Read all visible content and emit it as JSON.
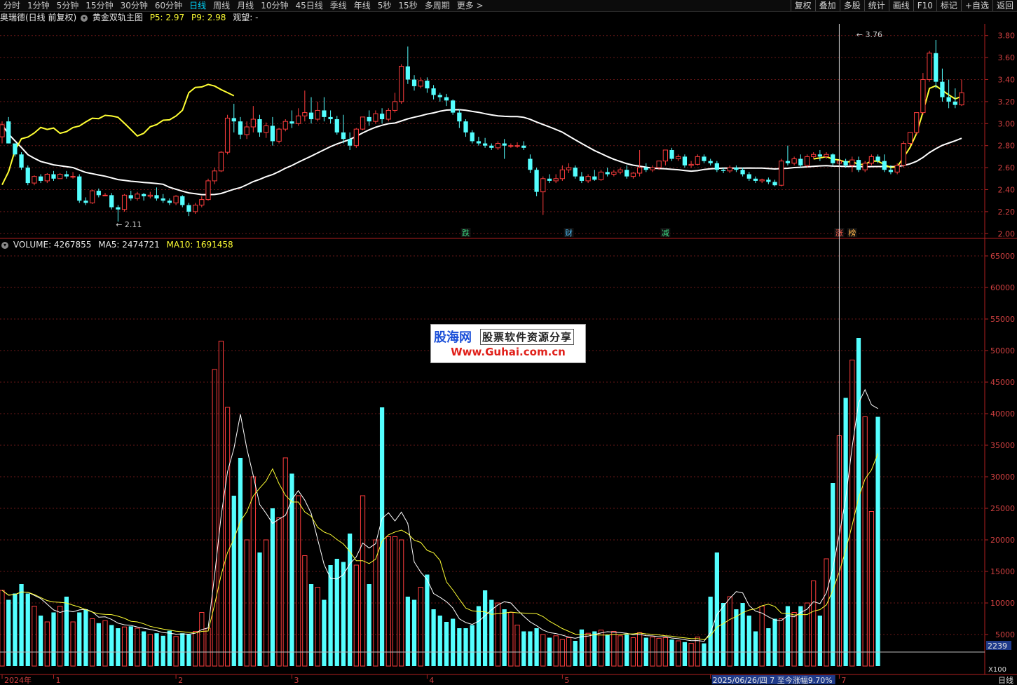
{
  "topbar": {
    "period_tabs": [
      "分时",
      "1分钟",
      "5分钟",
      "15分钟",
      "30分钟",
      "60分钟",
      "日线",
      "周线",
      "月线",
      "10分钟",
      "45日线",
      "季线",
      "年线",
      "5秒",
      "15秒",
      "多周期",
      "更多 >"
    ],
    "active_tab": "日线",
    "tool_tabs": [
      "复权",
      "叠加",
      "多股",
      "统计",
      "画线",
      "F10",
      "标记",
      "+自选",
      "返回"
    ]
  },
  "main_header": {
    "stock": "奥瑞德(日线 前复权)",
    "indicator": "黄金双轨主图",
    "p5_label": "P5: 2.97",
    "p9_label": "P9: 2.98",
    "view_label": "观望: -"
  },
  "volume_header": {
    "title": "VOLUME: 4267855",
    "ma5": "MA5: 2474721",
    "ma10": "MA10: 1691458"
  },
  "chart_data": [
    {
      "type": "candlestick",
      "title": "奥瑞德(日线 前复权)",
      "ylim": [
        1.97,
        3.9
      ],
      "y_ticks": [
        2.0,
        2.2,
        2.4,
        2.6,
        2.8,
        3.0,
        3.2,
        3.4,
        3.6,
        3.8
      ],
      "y_tick_labels": [
        "2.00",
        "2.20",
        "2.40",
        "2.60",
        "2.80",
        "3.00",
        "3.20",
        "3.40",
        "3.60",
        "3.80"
      ],
      "annotations": [
        {
          "text": "2.11",
          "bar": 17,
          "value": 2.11
        },
        {
          "text": "3.76",
          "bar": 132,
          "value": 3.76
        }
      ],
      "event_markers": [
        {
          "text": "跌",
          "bar": 72,
          "color": "#3ddc84"
        },
        {
          "text": "财",
          "bar": 88,
          "color": "#4fc3ff"
        },
        {
          "text": "减",
          "bar": 103,
          "color": "#3ddc84"
        },
        {
          "text": "涨",
          "bar": 130,
          "color": "#ff5a4a"
        },
        {
          "text": "榜",
          "bar": 132,
          "color": "#ffb34a"
        }
      ],
      "candles": [
        [
          2.88,
          3.02,
          2.99,
          2.82
        ],
        [
          3.02,
          3.06,
          2.82,
          2.82
        ],
        [
          2.82,
          2.82,
          2.72,
          2.7
        ],
        [
          2.72,
          2.74,
          2.6,
          2.58
        ],
        [
          2.6,
          2.62,
          2.46,
          2.44
        ],
        [
          2.46,
          2.53,
          2.52,
          2.44
        ],
        [
          2.52,
          2.54,
          2.48,
          2.46
        ],
        [
          2.48,
          2.55,
          2.54,
          2.46
        ],
        [
          2.54,
          2.57,
          2.5,
          2.48
        ],
        [
          2.5,
          2.55,
          2.54,
          2.5
        ],
        [
          2.54,
          2.57,
          2.52,
          2.5
        ],
        [
          2.52,
          2.56,
          2.52,
          2.5
        ],
        [
          2.52,
          2.54,
          2.3,
          2.28
        ],
        [
          2.3,
          2.33,
          2.28,
          2.26
        ],
        [
          2.28,
          2.4,
          2.39,
          2.27
        ],
        [
          2.39,
          2.41,
          2.35,
          2.33
        ],
        [
          2.35,
          2.37,
          2.35,
          2.35
        ],
        [
          2.35,
          2.37,
          2.24,
          2.22
        ],
        [
          2.24,
          2.26,
          2.22,
          2.11
        ],
        [
          2.22,
          2.36,
          2.35,
          2.2
        ],
        [
          2.35,
          2.39,
          2.32,
          2.3
        ],
        [
          2.32,
          2.38,
          2.36,
          2.3
        ],
        [
          2.36,
          2.37,
          2.34,
          2.3
        ],
        [
          2.34,
          2.38,
          2.35,
          2.32
        ],
        [
          2.35,
          2.42,
          2.32,
          2.3
        ],
        [
          2.32,
          2.36,
          2.3,
          2.28
        ],
        [
          2.3,
          2.32,
          2.28,
          2.26
        ],
        [
          2.28,
          2.35,
          2.34,
          2.26
        ],
        [
          2.34,
          2.35,
          2.26,
          2.24
        ],
        [
          2.26,
          2.28,
          2.2,
          2.16
        ],
        [
          2.2,
          2.28,
          2.26,
          2.18
        ],
        [
          2.26,
          2.34,
          2.31,
          2.24
        ],
        [
          2.31,
          2.5,
          2.48,
          2.3
        ],
        [
          2.48,
          2.6,
          2.57,
          2.45
        ],
        [
          2.57,
          2.75,
          2.74,
          2.56
        ],
        [
          2.74,
          3.08,
          3.05,
          2.72
        ],
        [
          3.05,
          3.18,
          3.02,
          2.92
        ],
        [
          3.02,
          3.06,
          2.9,
          2.86
        ],
        [
          2.9,
          3.02,
          2.97,
          2.86
        ],
        [
          2.97,
          3.16,
          3.04,
          2.92
        ],
        [
          3.04,
          3.08,
          2.92,
          2.88
        ],
        [
          2.92,
          3.01,
          2.98,
          2.87
        ],
        [
          2.98,
          3.06,
          2.84,
          2.8
        ],
        [
          2.84,
          2.96,
          2.95,
          2.82
        ],
        [
          2.95,
          3.04,
          3.02,
          2.93
        ],
        [
          3.02,
          3.12,
          3.0,
          2.96
        ],
        [
          3.0,
          3.14,
          3.07,
          2.98
        ],
        [
          3.07,
          3.3,
          3.1,
          3.02
        ],
        [
          3.1,
          3.24,
          3.04,
          3.0
        ],
        [
          3.04,
          3.2,
          3.12,
          3.02
        ],
        [
          3.12,
          3.24,
          3.06,
          3.02
        ],
        [
          3.06,
          3.12,
          3.04,
          3.0
        ],
        [
          3.04,
          3.07,
          2.92,
          2.9
        ],
        [
          2.92,
          3.08,
          2.86,
          2.82
        ],
        [
          2.86,
          2.92,
          2.8,
          2.76
        ],
        [
          2.8,
          2.96,
          2.95,
          2.78
        ],
        [
          2.95,
          3.05,
          3.06,
          2.94
        ],
        [
          3.06,
          3.12,
          3.02,
          2.98
        ],
        [
          3.02,
          3.12,
          3.09,
          3.0
        ],
        [
          3.09,
          3.14,
          3.04,
          3.0
        ],
        [
          3.04,
          3.14,
          3.12,
          3.02
        ],
        [
          3.12,
          3.28,
          3.2,
          3.1
        ],
        [
          3.2,
          3.54,
          3.52,
          3.18
        ],
        [
          3.52,
          3.7,
          3.4,
          3.36
        ],
        [
          3.4,
          3.44,
          3.34,
          3.3
        ],
        [
          3.34,
          3.42,
          3.39,
          3.32
        ],
        [
          3.39,
          3.42,
          3.32,
          3.28
        ],
        [
          3.32,
          3.35,
          3.26,
          3.22
        ],
        [
          3.26,
          3.28,
          3.24,
          3.2
        ],
        [
          3.24,
          3.27,
          3.21,
          3.16
        ],
        [
          3.21,
          3.22,
          3.1,
          3.08
        ],
        [
          3.1,
          3.13,
          3.02,
          2.96
        ],
        [
          3.02,
          3.04,
          2.92,
          2.88
        ],
        [
          2.92,
          2.94,
          2.84,
          2.82
        ],
        [
          2.84,
          2.88,
          2.82,
          2.8
        ],
        [
          2.82,
          2.87,
          2.8,
          2.78
        ],
        [
          2.8,
          2.82,
          2.78,
          2.76
        ],
        [
          2.78,
          2.84,
          2.82,
          2.76
        ],
        [
          2.82,
          2.86,
          2.8,
          2.68
        ],
        [
          2.8,
          2.82,
          2.8,
          2.78
        ],
        [
          2.8,
          2.83,
          2.8,
          2.78
        ],
        [
          2.8,
          2.84,
          2.78,
          2.76
        ],
        [
          2.68,
          2.72,
          2.58,
          2.55
        ],
        [
          2.58,
          2.6,
          2.38,
          2.34
        ],
        [
          2.38,
          2.52,
          2.5,
          2.17
        ],
        [
          2.5,
          2.54,
          2.48,
          2.46
        ],
        [
          2.48,
          2.54,
          2.5,
          2.46
        ],
        [
          2.5,
          2.62,
          2.58,
          2.48
        ],
        [
          2.58,
          2.64,
          2.6,
          2.55
        ],
        [
          2.6,
          2.62,
          2.52,
          2.5
        ],
        [
          2.52,
          2.56,
          2.48,
          2.46
        ],
        [
          2.48,
          2.54,
          2.52,
          2.46
        ],
        [
          2.52,
          2.58,
          2.49,
          2.48
        ],
        [
          2.49,
          2.58,
          2.56,
          2.48
        ],
        [
          2.56,
          2.6,
          2.54,
          2.52
        ],
        [
          2.54,
          2.58,
          2.56,
          2.52
        ],
        [
          2.56,
          2.6,
          2.58,
          2.54
        ],
        [
          2.58,
          2.62,
          2.52,
          2.5
        ],
        [
          2.52,
          2.56,
          2.55,
          2.5
        ],
        [
          2.55,
          2.76,
          2.6,
          2.52
        ],
        [
          2.6,
          2.64,
          2.58,
          2.56
        ],
        [
          2.58,
          2.62,
          2.6,
          2.56
        ],
        [
          2.6,
          2.66,
          2.66,
          2.58
        ],
        [
          2.66,
          2.76,
          2.76,
          2.62
        ],
        [
          2.76,
          2.78,
          2.68,
          2.66
        ],
        [
          2.68,
          2.72,
          2.7,
          2.66
        ],
        [
          2.7,
          2.72,
          2.62,
          2.6
        ],
        [
          2.62,
          2.66,
          2.63,
          2.6
        ],
        [
          2.63,
          2.72,
          2.7,
          2.62
        ],
        [
          2.7,
          2.72,
          2.66,
          2.64
        ],
        [
          2.66,
          2.68,
          2.64,
          2.62
        ],
        [
          2.64,
          2.66,
          2.58,
          2.56
        ],
        [
          2.58,
          2.6,
          2.57,
          2.55
        ],
        [
          2.57,
          2.62,
          2.6,
          2.55
        ],
        [
          2.6,
          2.62,
          2.58,
          2.56
        ],
        [
          2.58,
          2.6,
          2.54,
          2.52
        ],
        [
          2.54,
          2.56,
          2.5,
          2.48
        ],
        [
          2.5,
          2.52,
          2.48,
          2.46
        ],
        [
          2.48,
          2.5,
          2.49,
          2.46
        ],
        [
          2.49,
          2.51,
          2.47,
          2.45
        ],
        [
          2.47,
          2.49,
          2.44,
          2.43
        ],
        [
          2.44,
          2.68,
          2.66,
          2.43
        ],
        [
          2.66,
          2.8,
          2.64,
          2.62
        ],
        [
          2.64,
          2.7,
          2.68,
          2.62
        ],
        [
          2.68,
          2.72,
          2.62,
          2.6
        ],
        [
          2.62,
          2.72,
          2.7,
          2.6
        ],
        [
          2.7,
          2.74,
          2.72,
          2.68
        ],
        [
          2.72,
          2.76,
          2.7,
          2.66
        ],
        [
          2.7,
          2.74,
          2.72,
          2.68
        ],
        [
          2.72,
          2.73,
          2.64,
          2.62
        ],
        [
          2.64,
          2.68,
          2.66,
          2.62
        ],
        [
          2.66,
          2.68,
          2.62,
          2.6
        ],
        [
          2.62,
          2.7,
          2.67,
          2.56
        ],
        [
          2.67,
          2.7,
          2.58,
          2.56
        ],
        [
          2.58,
          2.66,
          2.64,
          2.56
        ],
        [
          2.64,
          2.72,
          2.7,
          2.62
        ],
        [
          2.7,
          2.72,
          2.66,
          2.64
        ],
        [
          2.66,
          2.72,
          2.58,
          2.56
        ],
        [
          2.58,
          2.62,
          2.56,
          2.54
        ],
        [
          2.56,
          2.64,
          2.62,
          2.54
        ],
        [
          2.62,
          2.84,
          2.82,
          2.6
        ],
        [
          2.82,
          2.92,
          2.92,
          2.8
        ],
        [
          2.92,
          3.06,
          3.1,
          2.9
        ],
        [
          3.1,
          3.46,
          3.4,
          3.08
        ],
        [
          3.4,
          3.66,
          3.64,
          3.38
        ],
        [
          3.64,
          3.76,
          3.38,
          3.32
        ],
        [
          3.38,
          3.5,
          3.24,
          3.2
        ],
        [
          3.24,
          3.4,
          3.2,
          3.14
        ],
        [
          3.2,
          3.32,
          3.17,
          3.14
        ],
        [
          3.17,
          3.4,
          3.28,
          3.16
        ]
      ],
      "lines": [
        {
          "name": "trail",
          "color": "#ffffff"
        },
        {
          "name": "fast",
          "color": "#ffff33"
        }
      ]
    },
    {
      "type": "bar",
      "title": "VOLUME",
      "ylim": [
        0,
        660000
      ],
      "y_ticks": [
        50000,
        100000,
        150000,
        200000,
        250000,
        300000,
        350000,
        400000,
        450000,
        500000,
        550000,
        600000,
        650000
      ],
      "y_tick_labels": [
        "5000",
        "10000",
        "15000",
        "20000",
        "25000",
        "30000",
        "35000",
        "40000",
        "45000",
        "50000",
        "55000",
        "60000",
        "65000"
      ],
      "current_value_label": "2239",
      "unit_label": "X100",
      "x_labels": [
        {
          "text": "2024年",
          "bar": 0
        },
        {
          "text": "1",
          "bar": 8
        },
        {
          "text": "2",
          "bar": 27
        },
        {
          "text": "3",
          "bar": 45
        },
        {
          "text": "4",
          "bar": 66
        },
        {
          "text": "5",
          "bar": 87
        },
        {
          "text": "2025/06/26/四 7 至今涨幅9.70%",
          "bar": 110
        },
        {
          "text": "7",
          "bar": 130
        }
      ],
      "bottom_right_label": "日线",
      "values": [
        120000,
        105000,
        115000,
        130000,
        115000,
        95000,
        80000,
        70000,
        85000,
        95000,
        110000,
        70000,
        85000,
        90000,
        75000,
        68000,
        72000,
        65000,
        60000,
        62000,
        63000,
        60000,
        55000,
        50000,
        52000,
        48000,
        56000,
        47000,
        52000,
        50000,
        55000,
        85000,
        60000,
        470000,
        515000,
        410000,
        270000,
        330000,
        200000,
        300000,
        180000,
        200000,
        250000,
        235000,
        330000,
        305000,
        270000,
        175000,
        130000,
        125000,
        105000,
        160000,
        170000,
        165000,
        210000,
        160000,
        270000,
        130000,
        200000,
        410000,
        205000,
        205000,
        200000,
        110000,
        105000,
        125000,
        145000,
        90000,
        80000,
        70000,
        75000,
        60000,
        60000,
        65000,
        95000,
        120000,
        105000,
        100000,
        90000,
        85000,
        65000,
        55000,
        55000,
        60000,
        50000,
        45000,
        48000,
        42000,
        45000,
        40000,
        58000,
        52000,
        55000,
        57000,
        50000,
        55000,
        48000,
        50000,
        45000,
        53000,
        45000,
        46000,
        44000,
        45000,
        42000,
        40000,
        38000,
        36000,
        46000,
        36000,
        110000,
        180000,
        100000,
        110000,
        90000,
        100000,
        80000,
        55000,
        95000,
        60000,
        75000,
        75000,
        95000,
        85000,
        95000,
        100000,
        135000,
        80000,
        170000,
        290000,
        365000,
        425000,
        485000,
        520000,
        395000,
        245000,
        395000
      ]
    }
  ],
  "watermark": {
    "brand": "股海网",
    "slogan": "股票软件资源分享",
    "url": "Www.Guhai.com.cn"
  }
}
